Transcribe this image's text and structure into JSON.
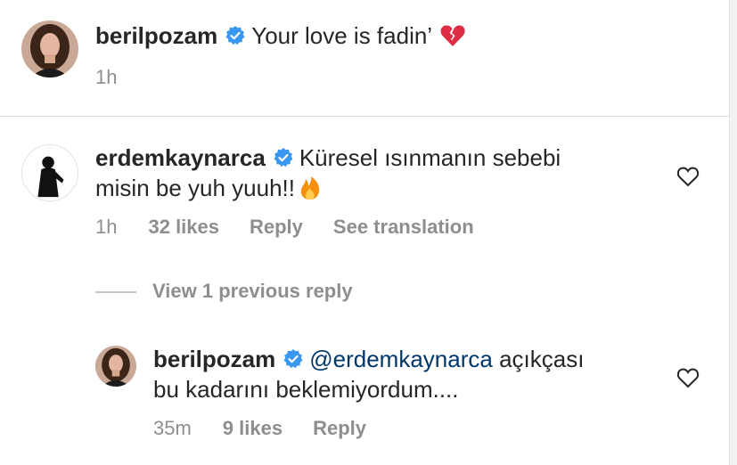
{
  "caption": {
    "username": "berilpozam",
    "text": "Your love is fadin’",
    "emoji": "broken-heart-emoji",
    "time": "1h"
  },
  "comment": {
    "username": "erdemkaynarca",
    "text_line1": "Küresel ısınmanın sebebi",
    "text_line2": "misin be yuh yuuh!!",
    "emoji": "fire-emoji",
    "time": "1h",
    "likes": "32 likes",
    "reply_label": "Reply",
    "translate_label": "See translation"
  },
  "view_replies_label": "View 1 previous reply",
  "reply": {
    "username": "berilpozam",
    "mention": "@erdemkaynarca",
    "text_line1": "açıkçası",
    "text_line2": "bu kadarını beklemiyordum....",
    "time": "35m",
    "likes": "9 likes",
    "reply_label": "Reply"
  },
  "colors": {
    "verified": "#3897f0",
    "mention": "#00376b",
    "muted": "#8e8e8e",
    "text": "#262626"
  }
}
